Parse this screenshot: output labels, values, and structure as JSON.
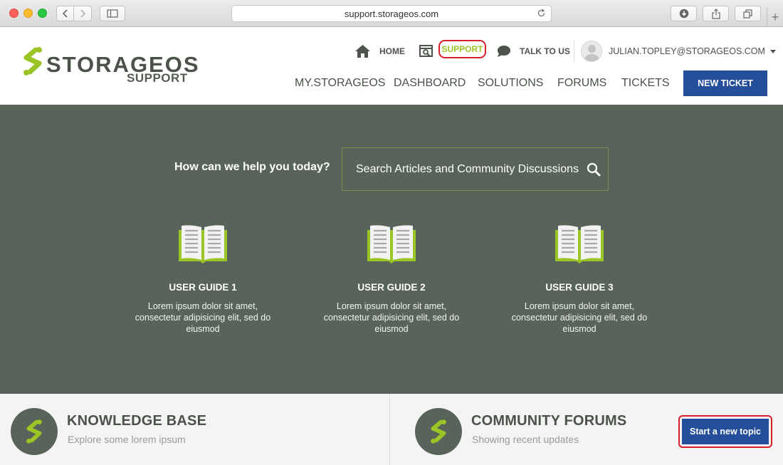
{
  "browser": {
    "url": "support.storageos.com",
    "icons": [
      "back-icon",
      "forward-icon",
      "sidebar-icon",
      "reload-icon",
      "download-icon",
      "share-icon",
      "tabs-icon",
      "new-tab-icon"
    ]
  },
  "brand": {
    "name": "STORAGEOS",
    "subtitle": "SUPPORT",
    "accent": "#9bc526",
    "dark": "#4a5249"
  },
  "util_nav": {
    "home": "HOME",
    "support": "SUPPORT",
    "talk": "TALK TO US",
    "user_email": "JULIAN.TOPLEY@STORAGEOS.COM"
  },
  "main_nav": {
    "items": [
      "MY.STORAGEOS",
      "DASHBOARD",
      "SOLUTIONS",
      "FORUMS",
      "TICKETS"
    ],
    "new_ticket": "NEW TICKET"
  },
  "hero": {
    "question": "How can we help you today?",
    "search_placeholder": "Search Articles and Community Discussions",
    "guides": [
      {
        "title": "USER GUIDE 1",
        "desc": "Lorem ipsum dolor sit amet, consectetur adipisicing elit, sed do eiusmod"
      },
      {
        "title": "USER GUIDE 2",
        "desc": "Lorem ipsum dolor sit amet, consectetur adipisicing elit, sed do eiusmod"
      },
      {
        "title": "USER GUIDE 3",
        "desc": "Lorem ipsum dolor sit amet, consectetur adipisicing elit, sed do eiusmod"
      }
    ]
  },
  "panels": {
    "kb": {
      "title": "KNOWLEDGE BASE",
      "subtitle": "Explore some lorem ipsum"
    },
    "forums": {
      "title": "COMMUNITY FORUMS",
      "subtitle": "Showing recent updates",
      "button": "Start a new topic"
    }
  },
  "colors": {
    "hero_bg": "#586359",
    "button_blue": "#244e9a",
    "highlight_red": "#d4202b"
  }
}
